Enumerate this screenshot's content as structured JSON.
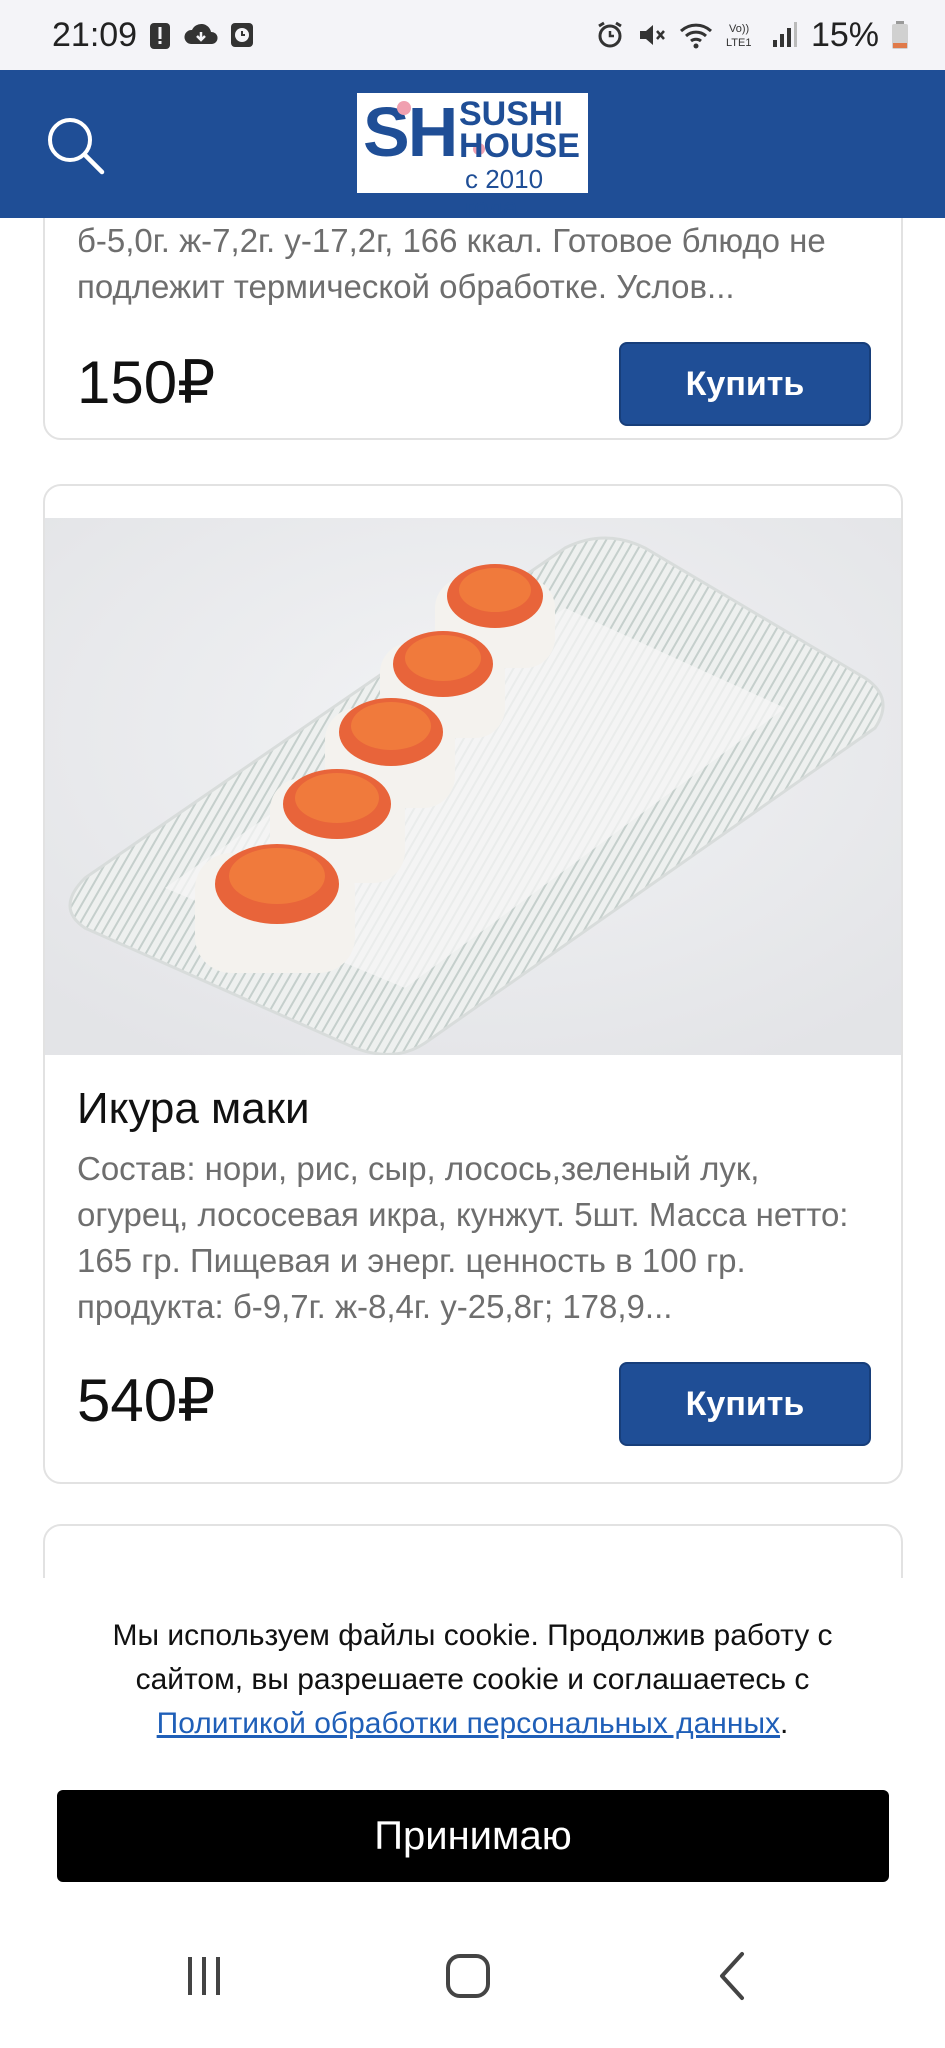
{
  "status_bar": {
    "time": "21:09",
    "battery_percent": "15%",
    "left_icons": [
      "alert-icon",
      "cloud-icon",
      "clock-app-icon"
    ],
    "right_icons": [
      "alarm-icon",
      "mute-icon",
      "wifi-icon",
      "volte-icon",
      "signal-icon",
      "battery-icon"
    ],
    "volte_label": "Vo)) LTE1"
  },
  "header": {
    "bg_color": "#1f4e96",
    "logo": {
      "mark": "SH",
      "line1": "SUSHI",
      "line2": "HOUSE",
      "since": "с 2010 года"
    },
    "search_icon": "search-icon"
  },
  "products": [
    {
      "description": "б-5,0г. ж-7,2г. у-17,2г, 166 ккал. Готовое блюдо не подлежит термической обработке. Услов...",
      "price": "150₽",
      "buy_label": "Купить"
    },
    {
      "title": "Икура маки",
      "description": "Состав: нори, рис, сыр, лосось,зеленый лук, огурец, лососевая икра, кунжут. 5шт. Масса нетто: 165 гр. Пищевая и энерг. ценность в 100 гр. продукта: б-9,7г. ж-8,4г. у-25,8г; 178,9...",
      "price": "540₽",
      "buy_label": "Купить"
    }
  ],
  "cookie": {
    "text": "Мы используем файлы cookie. Продолжив работу с сайтом, вы разрешаете cookie и соглашаетесь с",
    "link_text": "Политикой обработки персональных данных",
    "after_link": ".",
    "accept_label": "Принимаю"
  },
  "navbar": {
    "buttons": [
      "recent-apps-icon",
      "home-icon",
      "back-icon"
    ]
  }
}
